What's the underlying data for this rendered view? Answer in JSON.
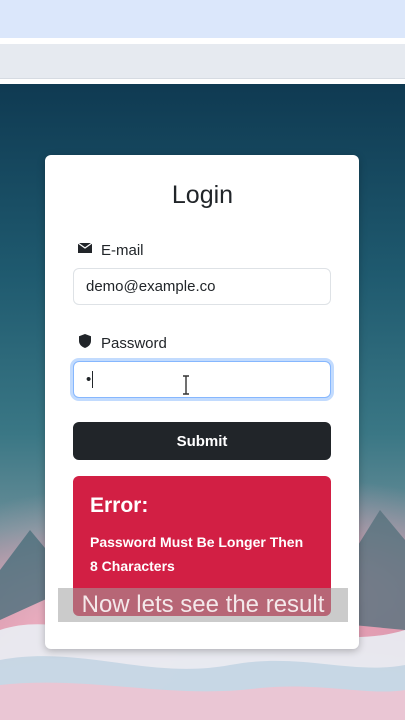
{
  "login": {
    "title": "Login",
    "email_label": "E-mail",
    "email_value": "demo@example.co",
    "password_label": "Password",
    "password_value": "•",
    "submit_label": "Submit"
  },
  "error": {
    "title": "Error:",
    "message": "Password Must Be Longer Then 8 Characters"
  },
  "caption": {
    "text": "Now lets see the result"
  },
  "icons": {
    "email": "envelope-icon",
    "password": "shield-icon"
  },
  "colors": {
    "submit_bg": "#212529",
    "error_bg": "#d21f44",
    "focus_border": "#86b7fe"
  }
}
